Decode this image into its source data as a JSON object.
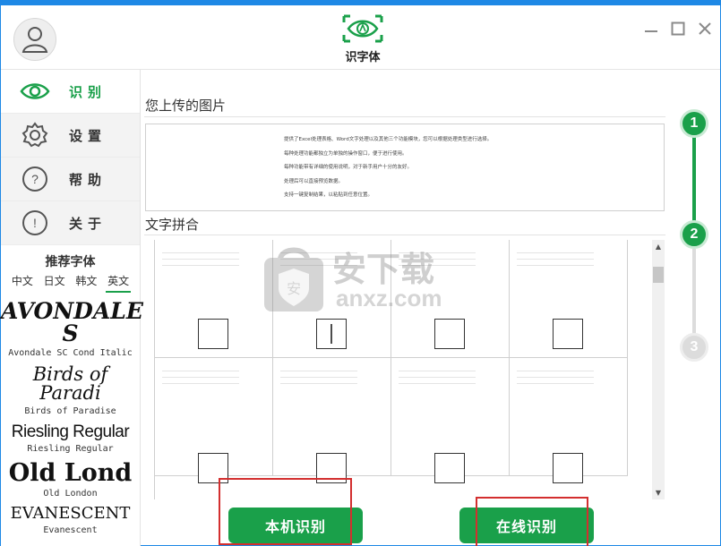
{
  "app": {
    "title": "识字体",
    "accent": "#1aa04a",
    "window_border": "#1e88e5"
  },
  "window_controls": {
    "minimize": "minimize-icon",
    "maximize": "maximize-icon",
    "close": "close-icon"
  },
  "sidebar": {
    "items": [
      {
        "label": "识别",
        "icon": "eye-icon",
        "active": true
      },
      {
        "label": "设置",
        "icon": "gear-icon",
        "active": false
      },
      {
        "label": "帮助",
        "icon": "help-icon",
        "active": false
      },
      {
        "label": "关于",
        "icon": "info-icon",
        "active": false
      }
    ],
    "fonts_title": "推荐字体",
    "font_tabs": [
      "中文",
      "日文",
      "韩文",
      "英文"
    ],
    "selected_tab": "英文",
    "samples": [
      {
        "display": "AVONDALE S",
        "name": "Avondale SC Cond Italic"
      },
      {
        "display": "Birds of Paradi",
        "name": "Birds of Paradise"
      },
      {
        "display": "Riesling Regular",
        "name": "Riesling Regular"
      },
      {
        "display": "Old Lond",
        "name": "Old London"
      },
      {
        "display": "EVANESCENT",
        "name": "Evanescent"
      }
    ]
  },
  "main": {
    "upload_title": "您上传的图片",
    "upload_lines": [
      "提供了Excel处理表格、Word文字处理以及其他三个功能模块，您可以根据处理类型进行选择。",
      "每种处理功能都独立为单独的操作窗口，便于进行使用。",
      "每种功能带有详细的使用说明，对于新手用户十分的友好。",
      "处理后可以直接预览数据。",
      "支持一键复制结果，以粘贴到任意位置。"
    ],
    "split_title": "文字拼合",
    "local_button": "本机识别",
    "online_button": "在线识别"
  },
  "steps": [
    "1",
    "2",
    "3"
  ],
  "current_step": 2,
  "watermark": {
    "text_top": "安下载",
    "text_bottom": "anxz.com"
  }
}
